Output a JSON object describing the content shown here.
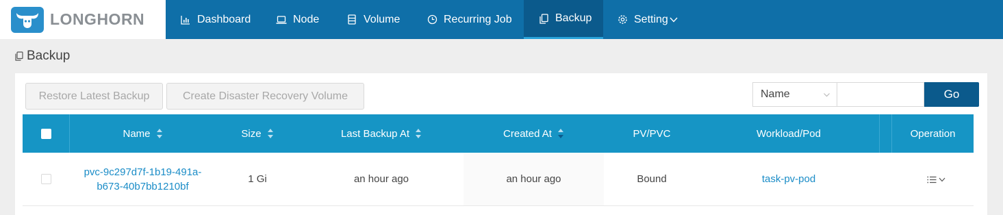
{
  "logo": {
    "text": "LONGHORN"
  },
  "nav": {
    "items": [
      {
        "label": "Dashboard",
        "icon": "bar-chart-icon"
      },
      {
        "label": "Node",
        "icon": "laptop-icon"
      },
      {
        "label": "Volume",
        "icon": "database-icon"
      },
      {
        "label": "Recurring Job",
        "icon": "clock-icon"
      },
      {
        "label": "Backup",
        "icon": "copy-icon",
        "active": true
      },
      {
        "label": "Setting",
        "icon": "gear-icon"
      }
    ]
  },
  "page": {
    "title": "Backup"
  },
  "toolbar": {
    "restore_label": "Restore Latest Backup",
    "create_dr_label": "Create Disaster Recovery Volume"
  },
  "search": {
    "field_selected": "Name",
    "value": "",
    "go_label": "Go"
  },
  "table": {
    "columns": [
      "Name",
      "Size",
      "Last Backup At",
      "Created At",
      "PV/PVC",
      "Workload/Pod",
      "Operation"
    ],
    "rows": [
      {
        "name_line1": "pvc-9c297d7f-1b19-491a-",
        "name_line2": "b673-40b7bb1210bf",
        "size": "1 Gi",
        "last_backup_at": "an hour ago",
        "created_at": "an hour ago",
        "pv_pvc": "Bound",
        "workload_pod": "task-pv-pod"
      }
    ]
  },
  "colors": {
    "nav_bg": "#0f6fa8",
    "nav_active_bg": "#0b5a8c",
    "table_header_bg": "#1695c5",
    "link": "#1a8cc7"
  }
}
